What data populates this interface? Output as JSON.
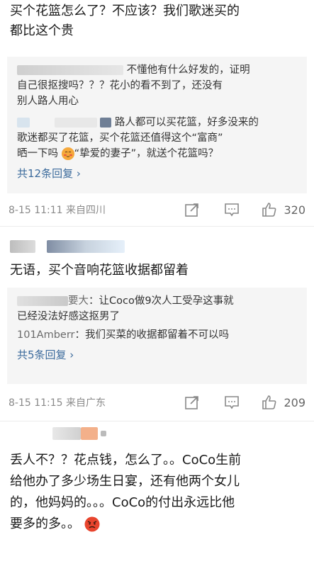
{
  "comment1": {
    "text_line1": "买个花篮怎么了？不应该？我们歌迷买的",
    "text_line2": "都比这个贵",
    "replies": [
      {
        "text_line1": "不懂他有什么好发的，证明",
        "text_line2": "自己很抠搜吗？？？花小的看不到了，还没有",
        "text_line3": "别人路人用心"
      },
      {
        "text_line1": "路人都可以买花篮，好多没来的",
        "text_line2": "歌迷都买了花篮，买个花篮还值得这个“富商”",
        "text_line3a": "晒一下吗",
        "text_line3b": "“挚爱的妻子”，就送个花篮吗？"
      }
    ],
    "more_replies": "共12条回复 ›",
    "timestamp": "8-15 11:11",
    "location": "来自四川",
    "likes": "320"
  },
  "comment2": {
    "text": "无语，买个音响花篮收据都留着",
    "replies": [
      {
        "username_tail": "要大",
        "text": "：让Coco做9次人工受孕这事就",
        "text_line2": "已经没法好感这抠男了"
      },
      {
        "username": "101Amberr",
        "text": "：我们买菜的收据都留着不可以吗"
      }
    ],
    "more_replies": "共5条回复 ›",
    "timestamp": "8-15 11:15",
    "location": "来自广东",
    "likes": "209"
  },
  "comment3": {
    "text_line1": "丢人不？？花点钱，怎么了。。CoCo生前",
    "text_line2": "给他办了多少场生日宴，还有他两个女儿",
    "text_line3": "的，他妈妈的。。。CoCo的付出永远比他",
    "text_line4": "要多的多。。"
  },
  "icons": {
    "share": "share-icon",
    "comment": "comment-icon",
    "like": "thumbs-up-icon",
    "angry_emoji": "angry-face-icon",
    "blush_emoji": "blush-face-icon"
  },
  "colors": {
    "link": "#3b6a9c",
    "reply_bg": "#f5f5f5",
    "meta": "#8a8a8a"
  }
}
